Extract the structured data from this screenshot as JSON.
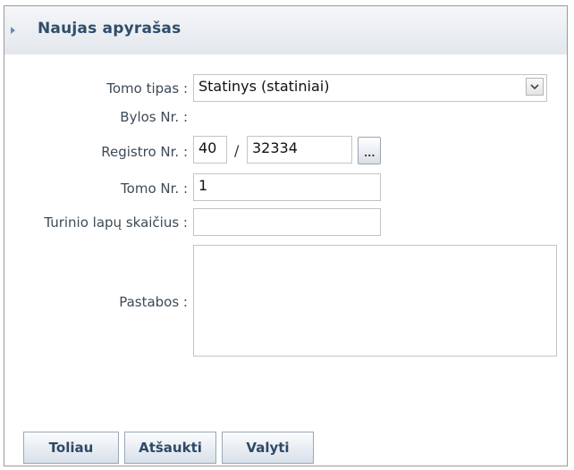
{
  "header": {
    "title": "Naujas apyrašas"
  },
  "form": {
    "tomo_tipas": {
      "label": "Tomo tipas :",
      "value": "Statinys (statiniai)"
    },
    "bylos_nr": {
      "label": "Bylos Nr. :"
    },
    "registro_nr": {
      "label": "Registro Nr. :",
      "prefix": "40",
      "separator": "/",
      "number": "32334",
      "lookup_label": "..."
    },
    "tomo_nr": {
      "label": "Tomo Nr. :",
      "value": "1"
    },
    "turinio_lapu": {
      "label": "Turinio lapų skaičius :",
      "value": ""
    },
    "pastabos": {
      "label": "Pastabos :",
      "value": ""
    }
  },
  "buttons": {
    "next": "Toliau",
    "cancel": "Atšaukti",
    "clear": "Valyti"
  }
}
